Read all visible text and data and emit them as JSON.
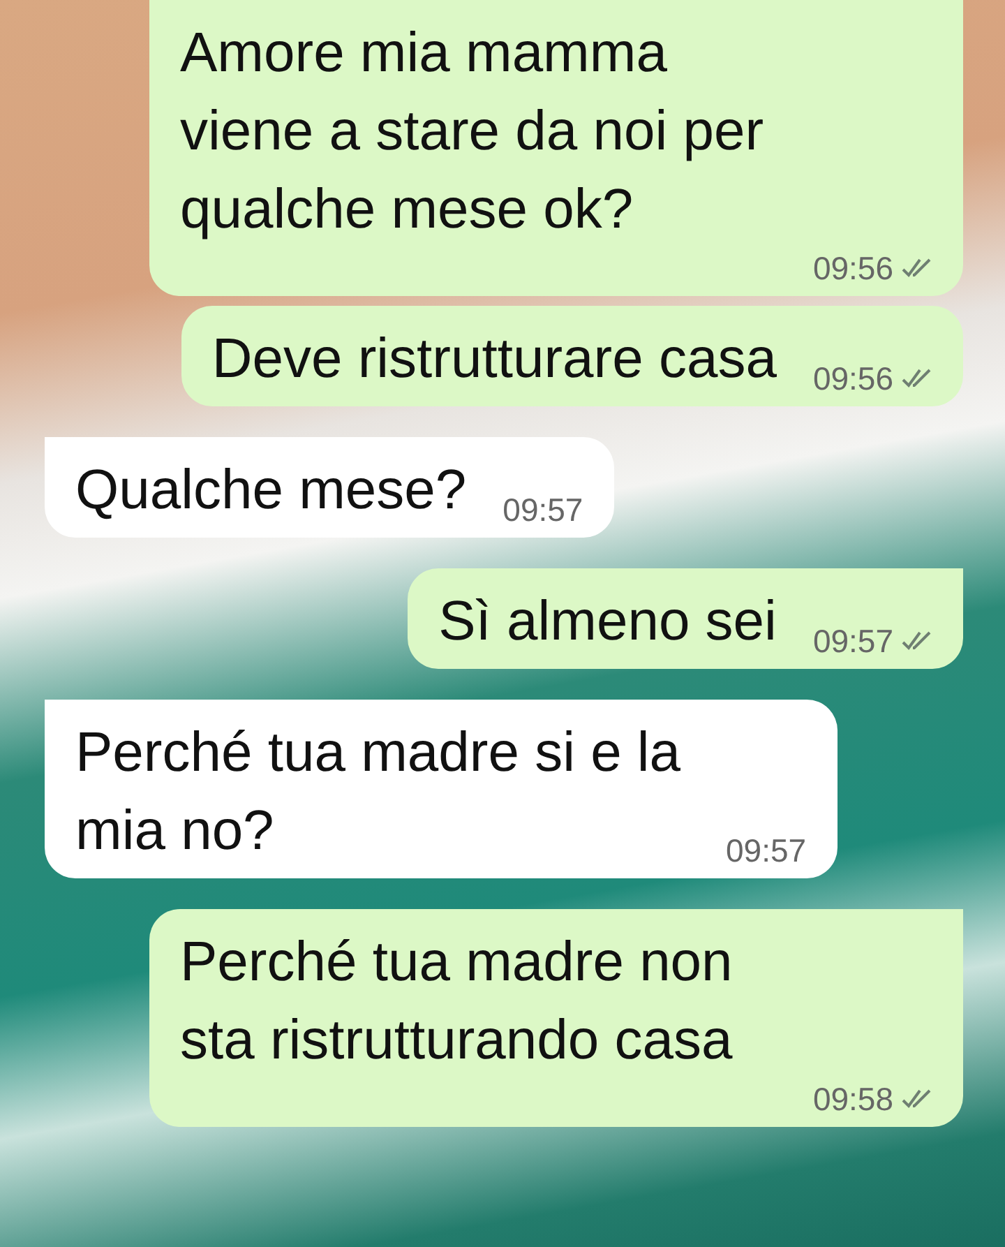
{
  "messages": [
    {
      "kind": "outgoing",
      "text": "Amore mia mamma viene a stare da noi per qualche mese ok?",
      "time": "09:56",
      "read": false
    },
    {
      "kind": "outgoing",
      "text": "Deve ristrutturare casa",
      "time": "09:56",
      "read": false
    },
    {
      "kind": "incoming",
      "text": "Qualche mese?",
      "time": "09:57"
    },
    {
      "kind": "outgoing",
      "text": "Sì almeno sei",
      "time": "09:57",
      "read": false
    },
    {
      "kind": "incoming",
      "text": "Perché tua madre si e la mia no?",
      "time": "09:57"
    },
    {
      "kind": "outgoing",
      "text": "Perché tua madre non sta ristrutturando casa",
      "time": "09:58",
      "read": false
    }
  ]
}
